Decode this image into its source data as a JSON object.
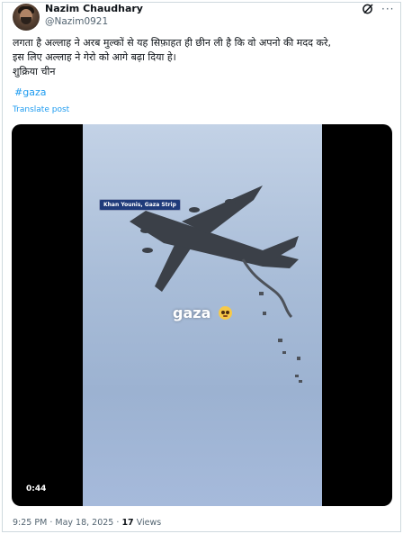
{
  "author": {
    "name": "Nazim Chaudhary",
    "handle": "@Nazim0921",
    "avatar_icon": "profile-avatar"
  },
  "header_icons": {
    "grok": "grok-icon",
    "more": "more-options-icon"
  },
  "post": {
    "lines": [
      "लगता है अल्लाह ने अरब मुल्कों से यह सिफ़ाहत ही छीन ली है कि वो अपनो की मदद करे,",
      "इस लिए अल्लाह ने गेरो को आगे बढ़ा दिया हे।",
      "शुक्रिया चीन"
    ],
    "hashtag": "#gaza",
    "translate_label": "Translate post"
  },
  "video": {
    "location_label": "Khan Younis, Gaza Strip",
    "overlay_text": "gaza",
    "overlay_emoji": "pleading-face-emoji",
    "duration": "0:44"
  },
  "meta": {
    "time": "9:25 PM",
    "separator": "·",
    "date": "May 18, 2025",
    "views_count": "17",
    "views_label": "Views"
  },
  "colors": {
    "link": "#1d9bf0",
    "secondary_text": "#536471",
    "primary_text": "#0f1419",
    "border": "#cfd9de"
  }
}
